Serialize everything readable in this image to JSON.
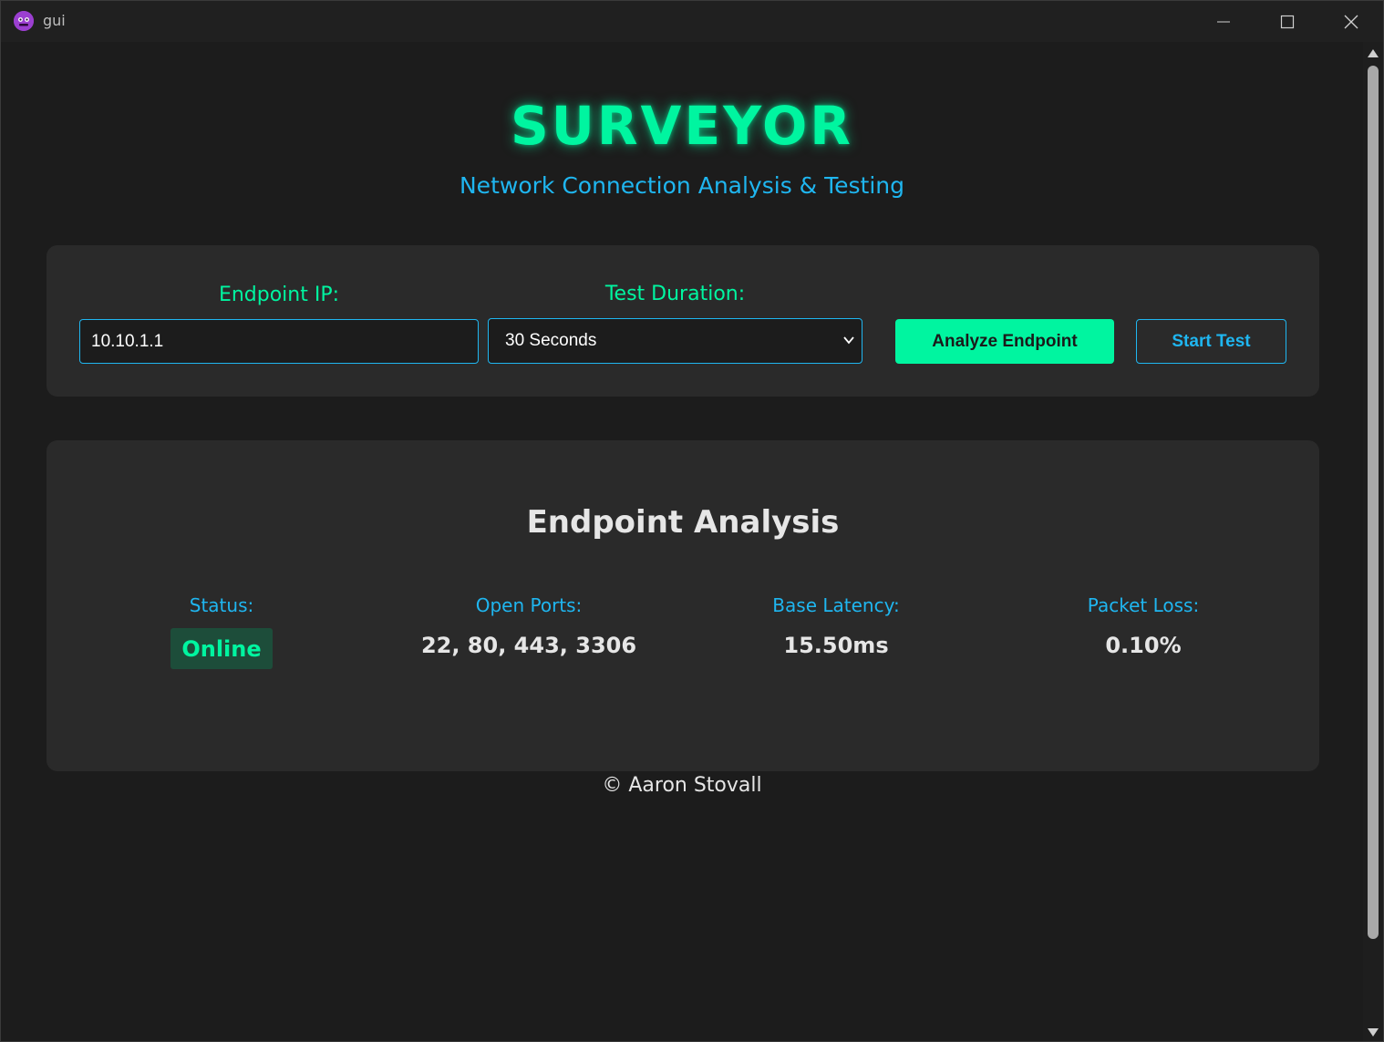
{
  "window": {
    "title": "gui",
    "icon": "app-icon"
  },
  "header": {
    "title": "SURVEYOR",
    "subtitle": "Network Connection Analysis & Testing"
  },
  "controls": {
    "endpoint_label": "Endpoint IP:",
    "endpoint_value": "10.10.1.1",
    "duration_label": "Test Duration:",
    "duration_selected": "30 Seconds",
    "analyze_label": "Analyze Endpoint",
    "start_label": "Start Test"
  },
  "analysis": {
    "title": "Endpoint Analysis",
    "status_label": "Status:",
    "status_value": "Online",
    "ports_label": "Open Ports:",
    "ports_value": "22, 80, 443, 3306",
    "latency_label": "Base Latency:",
    "latency_value": "15.50ms",
    "loss_label": "Packet Loss:",
    "loss_value": "0.10%"
  },
  "footer": {
    "text": "© Aaron Stovall"
  },
  "colors": {
    "accent_green": "#00f5a0",
    "accent_blue": "#1fb6f0",
    "background": "#1c1c1c",
    "panel": "#2a2a2a"
  }
}
